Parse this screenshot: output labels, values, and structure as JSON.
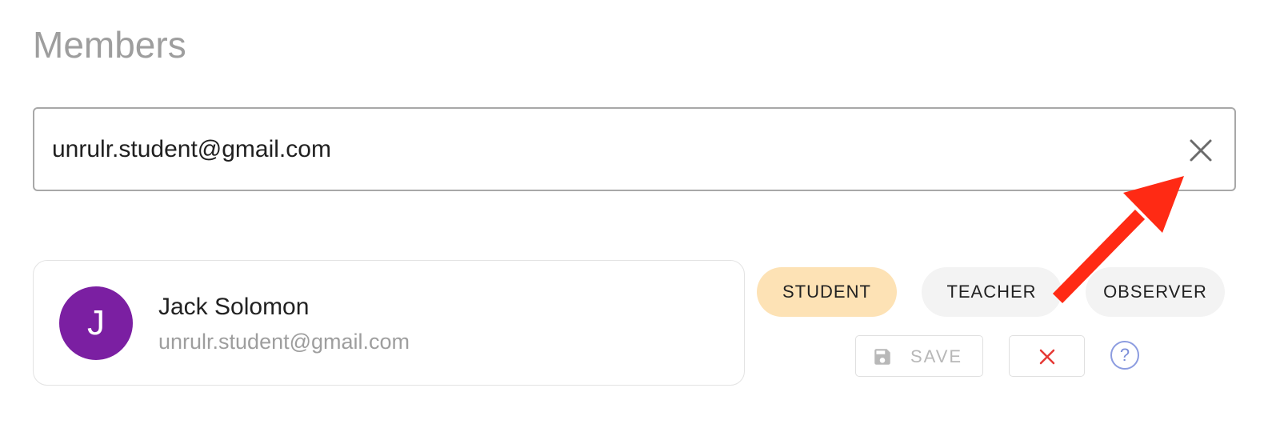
{
  "page": {
    "title": "Members"
  },
  "search": {
    "value": "unrulr.student@gmail.com",
    "clear_icon": "close-icon"
  },
  "member": {
    "avatar_initial": "J",
    "avatar_color": "#7b1fa2",
    "name": "Jack Solomon",
    "email": "unrulr.student@gmail.com"
  },
  "roles": {
    "student": "STUDENT",
    "teacher": "TEACHER",
    "observer": "OBSERVER",
    "selected": "STUDENT",
    "selected_color": "#fde2b5"
  },
  "actions": {
    "save_label": "SAVE",
    "save_icon": "floppy-disk-icon",
    "cancel_icon": "close-icon",
    "help_label": "?"
  },
  "annotation": {
    "arrow_color": "#ff2a14",
    "arrow_icon": "arrow-annotation"
  }
}
